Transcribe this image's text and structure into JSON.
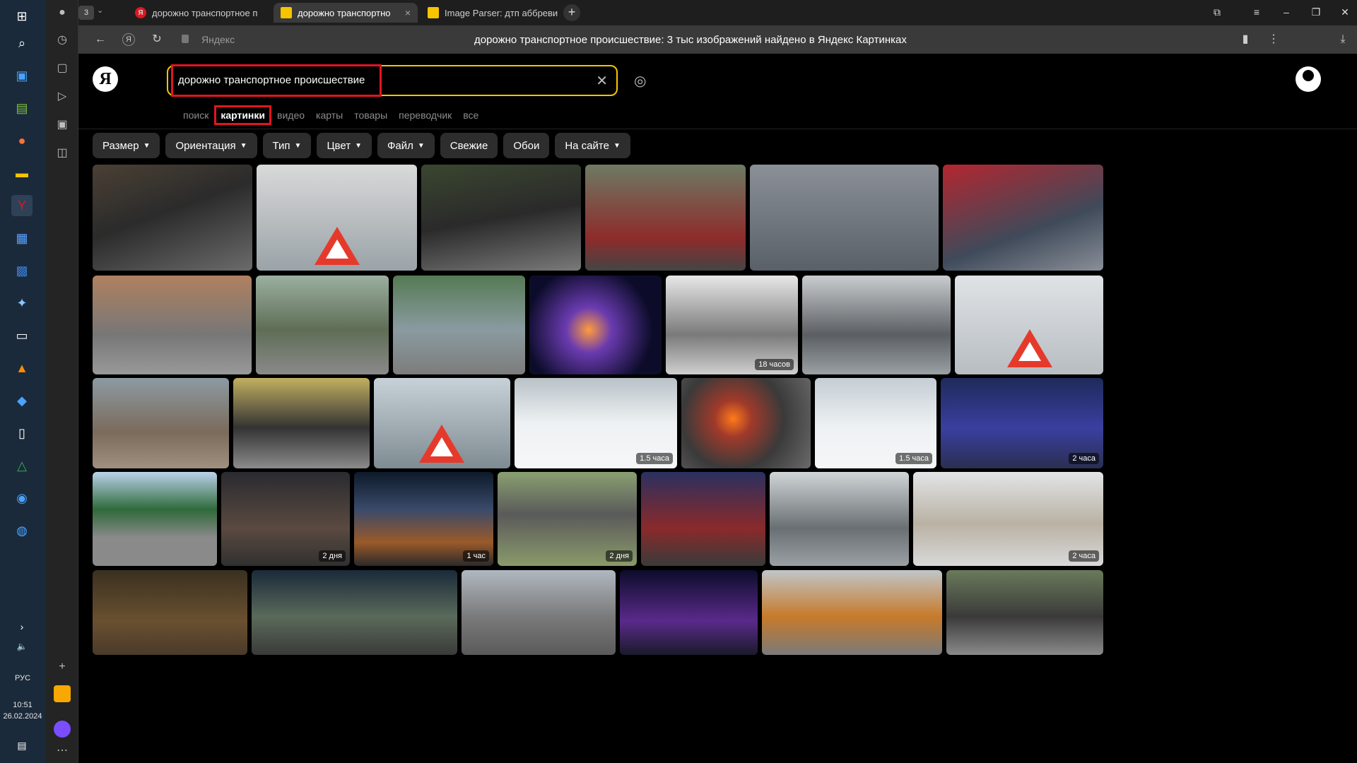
{
  "taskbar": {
    "lang": "РУС",
    "time": "10:51",
    "date": "26.02.2024"
  },
  "tabs": [
    {
      "label": "дорожно транспортное п",
      "fav_color": "#e2151f",
      "fav_text": "Я"
    },
    {
      "label": "дорожно транспортно",
      "fav_color": "#f8c400",
      "fav_text": ""
    },
    {
      "label": "Image Parser: дтп аббреви",
      "fav_color": "#f8c400",
      "fav_text": ""
    }
  ],
  "tab_count_badge": "3",
  "address": {
    "host": "Яндекс",
    "title": "дорожно транспортное происшествие: 3 тыс изображений найдено в Яндекс Картинках"
  },
  "search": {
    "query": "дорожно транспортное происшествие"
  },
  "services": [
    "поиск",
    "картинки",
    "видео",
    "карты",
    "товары",
    "переводчик",
    "все"
  ],
  "filters": [
    {
      "label": "Размер",
      "dropdown": true
    },
    {
      "label": "Ориентация",
      "dropdown": true
    },
    {
      "label": "Тип",
      "dropdown": true
    },
    {
      "label": "Цвет",
      "dropdown": true
    },
    {
      "label": "Файл",
      "dropdown": true
    },
    {
      "label": "Свежие",
      "dropdown": false
    },
    {
      "label": "Обои",
      "dropdown": false
    },
    {
      "label": "На сайте",
      "dropdown": true
    }
  ],
  "badges": {
    "b1": "18 часов",
    "b2": "1.5 часа",
    "b3": "1.5 часа",
    "b4": "2 часа",
    "b5": "2 дня",
    "b6": "1 час",
    "b7": "2 дня",
    "b8": "2 часа"
  }
}
